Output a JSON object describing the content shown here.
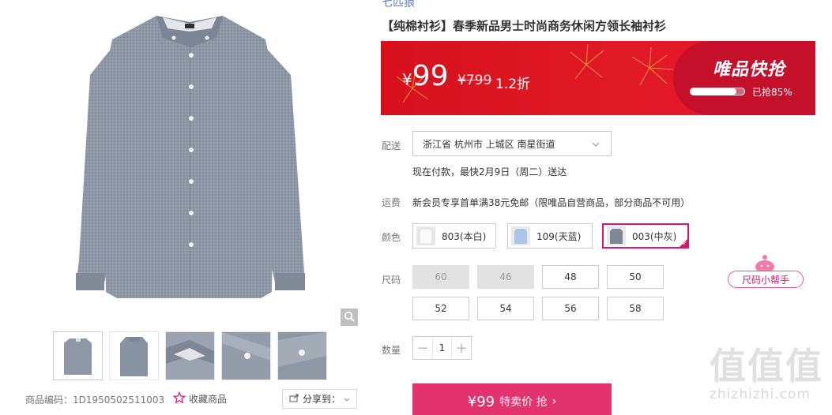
{
  "brand": "七匹狼",
  "title": "【纯棉衬衫】春季新品男士时尚商务休闲方领长袖衬衫",
  "banner": {
    "currency": "¥",
    "price": "99",
    "original_price": "¥799",
    "discount": "1.2折",
    "flash_label": "唯品快抢",
    "progress_fraction": 0.85,
    "progress_label": "已抢85%"
  },
  "delivery": {
    "label": "配送",
    "location": "浙江省 杭州市 上城区 南星街道",
    "note": "现在付款，最快2月9日（周二）送达"
  },
  "shipping": {
    "label": "运费",
    "text": "新会员专享首单满38元免邮（限唯品自营商品，部分商品不可用）"
  },
  "color": {
    "label": "颜色",
    "options": [
      {
        "name": "803(本白)",
        "selected": false
      },
      {
        "name": "109(天蓝)",
        "selected": false
      },
      {
        "name": "003(中灰)",
        "selected": true
      }
    ]
  },
  "size": {
    "label": "尺码",
    "options": [
      {
        "name": "60",
        "available": false
      },
      {
        "name": "46",
        "available": false
      },
      {
        "name": "48",
        "available": true
      },
      {
        "name": "50",
        "available": true
      },
      {
        "name": "52",
        "available": true
      },
      {
        "name": "54",
        "available": true
      },
      {
        "name": "56",
        "available": true
      },
      {
        "name": "58",
        "available": true
      }
    ],
    "helper": "尺码小帮手"
  },
  "quantity": {
    "label": "数量",
    "value": "1",
    "minus": "−",
    "plus": "+"
  },
  "buy_button": {
    "price": "¥99",
    "label": "特卖价 抢",
    "arrow": "›"
  },
  "gallery": {
    "product_code": "商品编码：1D1950502511003",
    "favorite": "收藏商品",
    "share": "分享到："
  },
  "watermark": {
    "big": "值值值",
    "small": "zhizhizhi.com"
  },
  "icons": {
    "zoom": "zoom-icon",
    "star": "star-icon",
    "share": "share-icon",
    "chevron": "chevron-down-icon"
  },
  "colors": {
    "accent": "#d6176f",
    "banner_red": "#d7101e",
    "buy_button": "#e2336f",
    "shirt_gray": "#8c96a4"
  }
}
